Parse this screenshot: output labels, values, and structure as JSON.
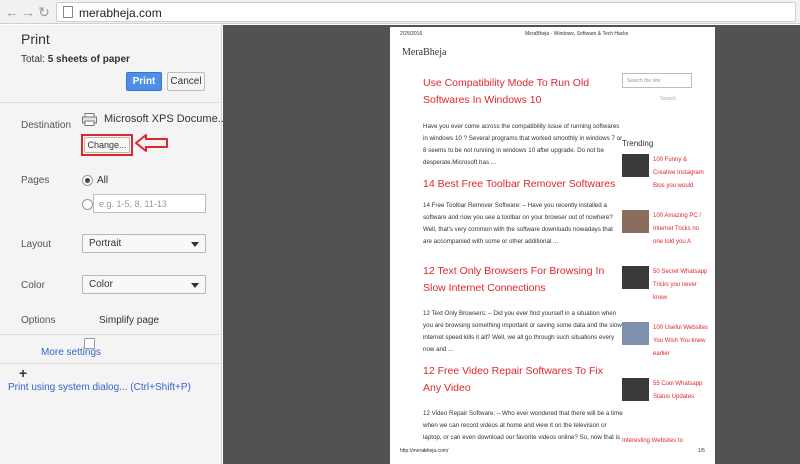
{
  "browser": {
    "url": "merabheja.com",
    "back_glyph": "←",
    "forward_glyph": "→",
    "reload_glyph": "↻"
  },
  "print_panel": {
    "title": "Print",
    "total_label": "Total:",
    "total_value": "5 sheets of paper",
    "print_button": "Print",
    "cancel_button": "Cancel",
    "destination_label": "Destination",
    "destination_value": "Microsoft XPS Docume...",
    "change_button": "Change...",
    "pages_label": "Pages",
    "pages_all": "All",
    "pages_placeholder": "e.g. 1-5, 8, 11-13",
    "layout_label": "Layout",
    "layout_value": "Portrait",
    "color_label": "Color",
    "color_value": "Color",
    "options_label": "Options",
    "simplify_label": "Simplify page",
    "more_settings": "More settings",
    "system_dialog": "Print using system dialog... (Ctrl+Shift+P)"
  },
  "colors": {
    "accent_blue": "#4d8ee8",
    "highlight_red": "#e0262b",
    "preview_bg": "#525252",
    "link_blue": "#3366cc"
  },
  "preview": {
    "header_date": "2/25/2016",
    "header_title": "MeraBheja - Windows, Software & Tech Hacks",
    "brand": "MeraBheja",
    "articles": [
      {
        "title": "Use Compatibility Mode To Run Old Softwares In Windows 10",
        "excerpt": "Have you ever come across the compatibility issue of running softwares in windows 10 ? Several programs that worked smoothly in windows 7 or 8 seems to be not running in windows 10 after upgrade. Do not be desperate.Microsoft has ..."
      },
      {
        "title": "14 Best Free Toolbar Remover Softwares",
        "excerpt": "14 Free Toolbar Remover Software: – Have you recently installed a software and now you see a toolbar on your browser out of nowhere? Well, that's very common with the software downloads nowadays that are accompanied with some or other additional ..."
      },
      {
        "title": "12 Text Only Browsers For Browsing In Slow Internet Connections",
        "excerpt": "12 Text Only Browsers: – Did you ever find yourself in a situation when you are browsing something important or saving some data and the slow internet speed kills it all? Well, we all go through such situations every now and ..."
      },
      {
        "title": "12 Free Video Repair Softwares To Fix Any Video",
        "excerpt": "12 Video Repair Software: – Who ever wondered that there will be a time when we can record videos at home and view it on the television or laptop, or can even download our favorite videos online? So, now that is ..."
      }
    ],
    "sidebar": {
      "search_placeholder": "Search the site",
      "search_button": "Search",
      "trending_heading": "Trending",
      "trending_items": [
        "100 Funny & Creative Instagram Bios you would",
        "100 Amazing PC / Internet Tricks no one told you A",
        "50 Secret Whatsapp Tricks you never knew",
        "100 Useful Websites You Wish You knew earlier",
        "55 Cool Whatsapp Status Updates"
      ],
      "last_item": "Interesting Websites to"
    },
    "footer_url": "http://merabheja.com/",
    "footer_page": "1/5"
  }
}
